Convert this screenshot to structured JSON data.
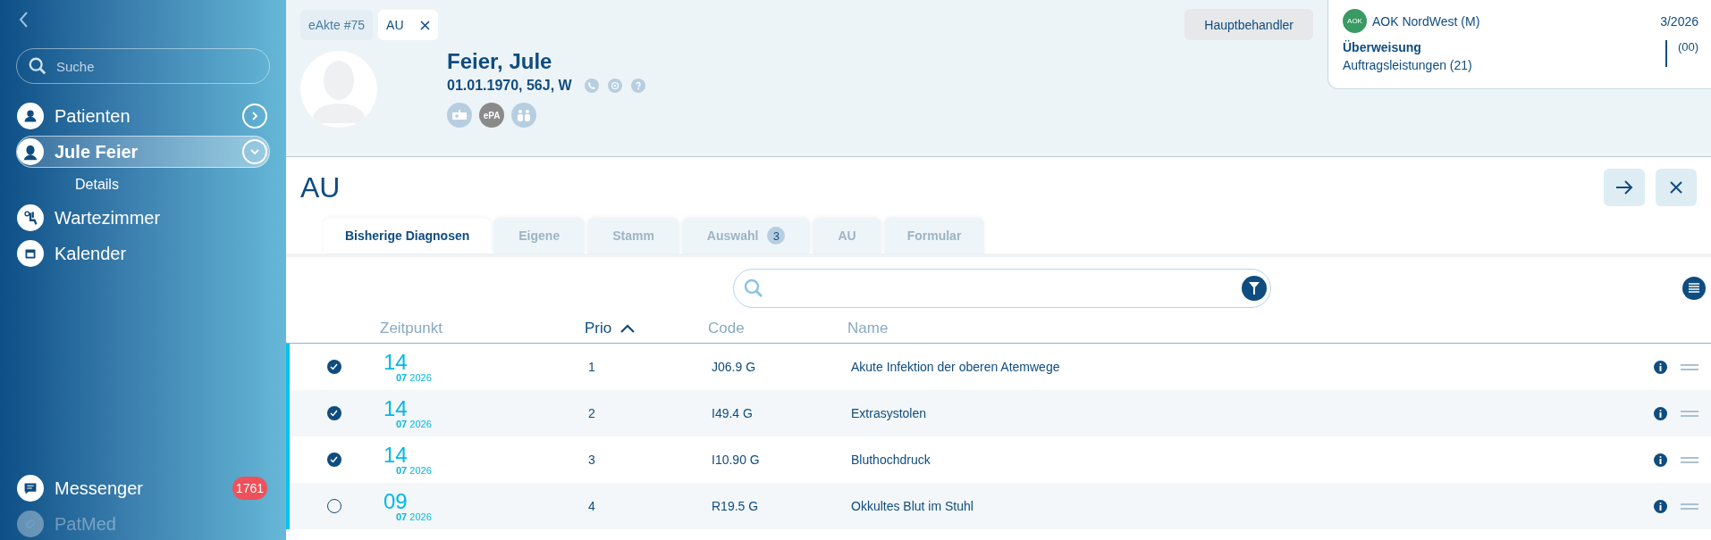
{
  "sidebar": {
    "search": {
      "placeholder": "Suche"
    },
    "items": [
      {
        "label": "Patienten",
        "kind": "patients",
        "selected": false,
        "expanded": false
      },
      {
        "label": "Jule Feier",
        "kind": "patient",
        "selected": true,
        "expanded": true,
        "children": [
          {
            "label": "Details"
          }
        ]
      },
      {
        "label": "Wartezimmer",
        "kind": "waiting",
        "selected": false
      },
      {
        "label": "Kalender",
        "kind": "calendar",
        "selected": false
      }
    ],
    "bottom_items": [
      {
        "label": "Messenger",
        "kind": "messenger",
        "badge": "1761",
        "disabled": false
      },
      {
        "label": "PatMed",
        "kind": "patmed",
        "disabled": true
      }
    ]
  },
  "doc_tabs": [
    {
      "label": "eAkte #75",
      "selected": false,
      "closable": false
    },
    {
      "label": "AU",
      "selected": true,
      "closable": true
    }
  ],
  "patient": {
    "name": "Feier,  Jule",
    "details": "01.01.1970, 56J, W",
    "badges": [
      {
        "kind": "ambulance"
      },
      {
        "kind": "epa",
        "label": "ePA"
      },
      {
        "kind": "people"
      }
    ]
  },
  "main_button": "Hauptbehandler",
  "insurance": {
    "name": "AOK NordWest (M)",
    "logo": "AOK",
    "quarter": "3/2026",
    "type": "Überweisung",
    "subtitle": "Auftragsleistungen (21)",
    "code": "(00)"
  },
  "page_title": "AU",
  "tabs": [
    {
      "label": "Bisherige Diagnosen",
      "selected": true
    },
    {
      "label": "Eigene",
      "selected": false
    },
    {
      "label": "Stamm",
      "selected": false
    },
    {
      "label": "Auswahl",
      "selected": false,
      "badge": "3"
    },
    {
      "label": "AU",
      "selected": false
    },
    {
      "label": "Formular",
      "selected": false
    }
  ],
  "table": {
    "columns": [
      {
        "label": "Zeitpunkt",
        "sorted": false
      },
      {
        "label": "Prio",
        "sorted": true
      },
      {
        "label": "Code",
        "sorted": false
      },
      {
        "label": "Name",
        "sorted": false
      }
    ],
    "rows": [
      {
        "checked": true,
        "day": "14",
        "month": "07",
        "year": "2026",
        "prio": "1",
        "code": "J06.9 G",
        "name": "Akute Infektion der oberen Atemwege"
      },
      {
        "checked": true,
        "day": "14",
        "month": "07",
        "year": "2026",
        "prio": "2",
        "code": "I49.4 G",
        "name": "Extrasystolen"
      },
      {
        "checked": true,
        "day": "14",
        "month": "07",
        "year": "2026",
        "prio": "3",
        "code": "I10.90 G",
        "name": "Bluthochdruck"
      },
      {
        "checked": false,
        "day": "09",
        "month": "07",
        "year": "2026",
        "prio": "4",
        "code": "R19.5 G",
        "name": "Okkultes Blut im Stuhl"
      }
    ]
  }
}
